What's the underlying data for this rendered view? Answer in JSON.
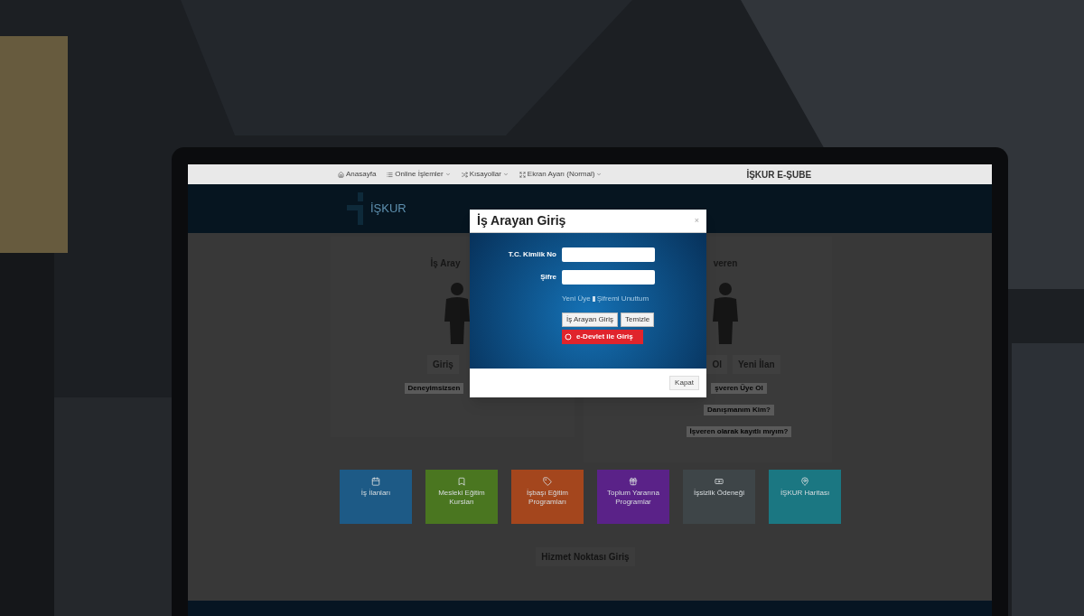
{
  "nav": {
    "items": [
      {
        "label": "Anasayfa",
        "dropdown": false
      },
      {
        "label": "Online İşlemler",
        "dropdown": true
      },
      {
        "label": "Kısayollar",
        "dropdown": true
      },
      {
        "label": "Ekran Ayarı (Normal)",
        "dropdown": true
      }
    ],
    "brand": "İŞKUR E-ŞUBE"
  },
  "logo": {
    "name": "İŞKUR"
  },
  "job_seeker_panel": {
    "title": "İş Aray",
    "buttons": [
      "Giriş"
    ],
    "links": [
      "Deneyimsizsen"
    ]
  },
  "employer_panel": {
    "title": "veren",
    "buttons": [
      "Ol",
      "Yeni İlan"
    ],
    "links": [
      "şveren Üye Ol",
      "Danışmanım Kim?",
      "İşveren olarak kayıtlı mıyım?"
    ]
  },
  "tiles": [
    {
      "label": "İş İlanları",
      "color": "#1d5a86"
    },
    {
      "label": "Mesleki Eğitim Kursları",
      "color": "#4a7620"
    },
    {
      "label": "İşbaşı Eğitim Programları",
      "color": "#a4461d"
    },
    {
      "label": "Toplum Yararına Programlar",
      "color": "#5a2288"
    },
    {
      "label": "İşsizlik Ödeneği",
      "color": "#3e4548"
    },
    {
      "label": "İŞKUR Haritası",
      "color": "#1b7782"
    }
  ],
  "service_point": "Hizmet Noktası Giriş",
  "modal": {
    "title": "İş Arayan Giriş",
    "close": "×",
    "fields": [
      {
        "label": "T.C. Kimlik No"
      },
      {
        "label": "Şifre"
      }
    ],
    "links": [
      "Yeni Üye",
      "Şifremi Unuttum"
    ],
    "buttons": [
      "İş Arayan Giriş",
      "Temizle"
    ],
    "edevlet": "e-Devlet ile Giriş",
    "footer_button": "Kapat"
  }
}
